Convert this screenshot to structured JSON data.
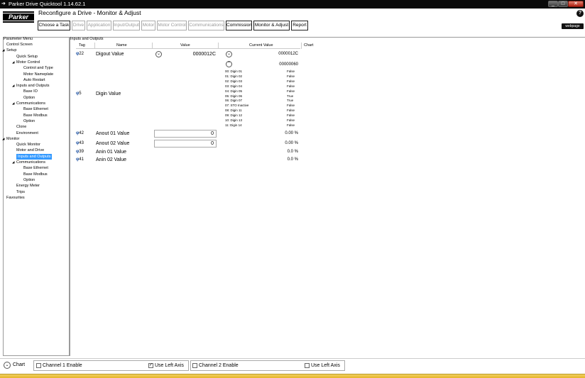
{
  "window": {
    "title": "Parker Drive Quicktool 1.14.62.1",
    "minimize": "_",
    "maximize": "□",
    "close": "✕"
  },
  "header": {
    "logo_text": "Parker",
    "heading": "Reconfigure a Drive - Monitor & Adjust",
    "help": "?",
    "webpage": "webpage"
  },
  "tabs": [
    {
      "label": "Choose a Task",
      "enabled": true
    },
    {
      "label": "Drive",
      "enabled": false
    },
    {
      "label": "Application",
      "enabled": false
    },
    {
      "label": "Input/Output",
      "enabled": false
    },
    {
      "label": "Motor",
      "enabled": false
    },
    {
      "label": "Motor Control",
      "enabled": false
    },
    {
      "label": "Communications",
      "enabled": false
    },
    {
      "label": "Commission",
      "enabled": true
    },
    {
      "label": "Monitor & Adjust",
      "enabled": true
    },
    {
      "label": "Report",
      "enabled": true
    }
  ],
  "left_pane": {
    "caption": "Parameter Menu",
    "tree": [
      {
        "label": "Control Screen",
        "level": 0,
        "arrow": ""
      },
      {
        "label": "Setup",
        "level": 0,
        "arrow": "◢"
      },
      {
        "label": "Quick Setup",
        "level": 1,
        "arrow": ""
      },
      {
        "label": "Motor Control",
        "level": 1,
        "arrow": "◢"
      },
      {
        "label": "Control and Type",
        "level": 2,
        "arrow": ""
      },
      {
        "label": "Motor Nameplate",
        "level": 2,
        "arrow": ""
      },
      {
        "label": "Auto Restart",
        "level": 2,
        "arrow": ""
      },
      {
        "label": "Inputs and Outputs",
        "level": 1,
        "arrow": "◢"
      },
      {
        "label": "Base IO",
        "level": 2,
        "arrow": ""
      },
      {
        "label": "Option",
        "level": 2,
        "arrow": ""
      },
      {
        "label": "Communications",
        "level": 1,
        "arrow": "◢"
      },
      {
        "label": "Base Ethernet",
        "level": 2,
        "arrow": ""
      },
      {
        "label": "Base Modbus",
        "level": 2,
        "arrow": ""
      },
      {
        "label": "Option",
        "level": 2,
        "arrow": ""
      },
      {
        "label": "Clone",
        "level": 1,
        "arrow": ""
      },
      {
        "label": "Environment",
        "level": 1,
        "arrow": ""
      },
      {
        "label": "Monitor",
        "level": 0,
        "arrow": "◢"
      },
      {
        "label": "Quick Monitor",
        "level": 1,
        "arrow": ""
      },
      {
        "label": "Motor and Drive",
        "level": 1,
        "arrow": ""
      },
      {
        "label": "Inputs and Outputs",
        "level": 1,
        "arrow": "",
        "selected": true
      },
      {
        "label": "Communications",
        "level": 1,
        "arrow": "◢"
      },
      {
        "label": "Base Ethernet",
        "level": 2,
        "arrow": ""
      },
      {
        "label": "Base Modbus",
        "level": 2,
        "arrow": ""
      },
      {
        "label": "Option",
        "level": 2,
        "arrow": ""
      },
      {
        "label": "Energy Meter",
        "level": 1,
        "arrow": ""
      },
      {
        "label": "Trips",
        "level": 1,
        "arrow": ""
      },
      {
        "label": "Favourites",
        "level": 0,
        "arrow": ""
      }
    ]
  },
  "main": {
    "caption": "Inputs and Outputs",
    "columns": {
      "tag": "Tag",
      "name": "Name",
      "value": "Value",
      "current": "Current Value",
      "chart": "Chart"
    },
    "pin_symbol": "φ",
    "expand_symbol": "⌄",
    "collapse_symbol": "⌃",
    "rows": [
      {
        "tag": "22",
        "name": "Digout Value",
        "value": "0000012C",
        "current": "0000012C"
      },
      {
        "tag": "5",
        "name": "Digin Value",
        "current": "00000060"
      },
      {
        "tag": "42",
        "name": "Anout 01 Value",
        "value": "0",
        "current": "0.00 %"
      },
      {
        "tag": "43",
        "name": "Anout 02 Value",
        "value": "0",
        "current": "0.00 %"
      },
      {
        "tag": "39",
        "name": "Anin 01 Value",
        "current": "0.0 %"
      },
      {
        "tag": "41",
        "name": "Anin 02 Value",
        "current": "0.0 %"
      }
    ],
    "digin_bits": [
      {
        "name": "00: Digin 01",
        "value": "False"
      },
      {
        "name": "01: Digin 02",
        "value": "False"
      },
      {
        "name": "02: Digin 03",
        "value": "False"
      },
      {
        "name": "03: Digin 04",
        "value": "False"
      },
      {
        "name": "04: Digin 05",
        "value": "False"
      },
      {
        "name": "05: Digin 06",
        "value": "True"
      },
      {
        "name": "06: Digin 07",
        "value": "True"
      },
      {
        "name": "07: STO Inactive",
        "value": "False"
      },
      {
        "name": "08: Digin 11",
        "value": "False"
      },
      {
        "name": "09: Digin 12",
        "value": "False"
      },
      {
        "name": "10: Digin 13",
        "value": "False"
      },
      {
        "name": "11: Digin 14",
        "value": "False"
      }
    ]
  },
  "bottom": {
    "chart_label": "Chart",
    "toggle_symbol": "⌄",
    "check_mark": "✓",
    "channel1_label": "Channel 1 Enable",
    "channel1_checked": false,
    "left_axis1_label": "Use Left Axis",
    "left_axis1_checked": true,
    "channel2_label": "Channel 2 Enable",
    "channel2_checked": false,
    "left_axis2_label": "Use Left Axis",
    "left_axis2_checked": false
  }
}
